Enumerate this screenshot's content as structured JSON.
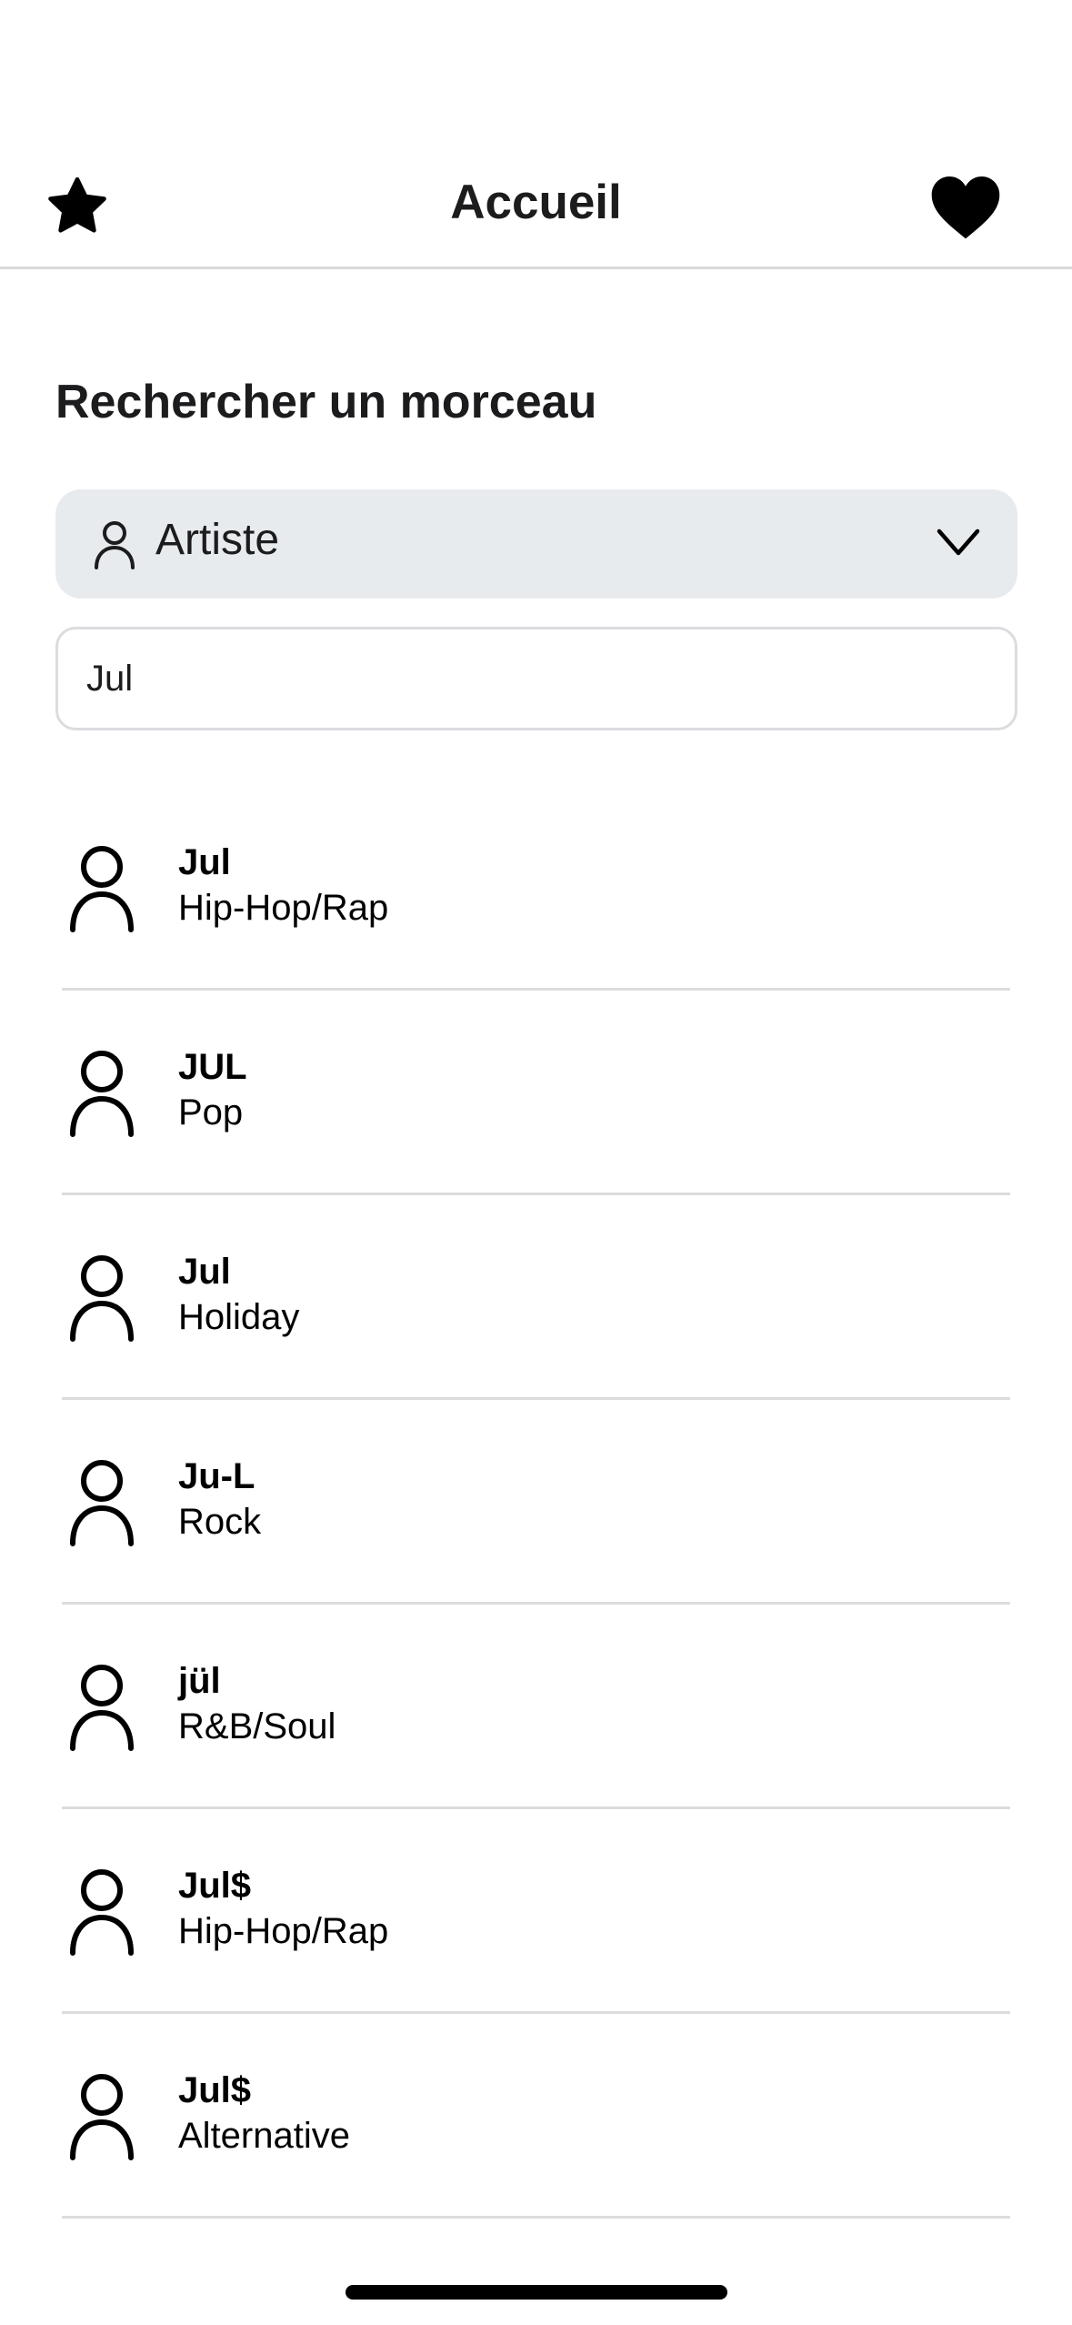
{
  "nav": {
    "title": "Accueil",
    "left_icon": "star-icon",
    "right_icon": "heart-icon"
  },
  "search": {
    "section_title": "Rechercher un morceau",
    "picker": {
      "icon": "person-icon",
      "selected": "Artiste",
      "chevron": "chevron-down-icon"
    },
    "query": "Jul"
  },
  "results": [
    {
      "name": "Jul",
      "genre": "Hip-Hop/Rap",
      "icon": "person-icon"
    },
    {
      "name": "JUL",
      "genre": "Pop",
      "icon": "person-icon"
    },
    {
      "name": "Jul",
      "genre": "Holiday",
      "icon": "person-icon"
    },
    {
      "name": "Ju-L",
      "genre": "Rock",
      "icon": "person-icon"
    },
    {
      "name": "jül",
      "genre": "R&B/Soul",
      "icon": "person-icon"
    },
    {
      "name": "Jul$",
      "genre": "Hip-Hop/Rap",
      "icon": "person-icon"
    },
    {
      "name": "Jul$",
      "genre": "Alternative",
      "icon": "person-icon"
    }
  ],
  "colors": {
    "picker_bg": "#e8ebee",
    "separator": "#dcdcdf",
    "text": "#1c1c1e"
  }
}
